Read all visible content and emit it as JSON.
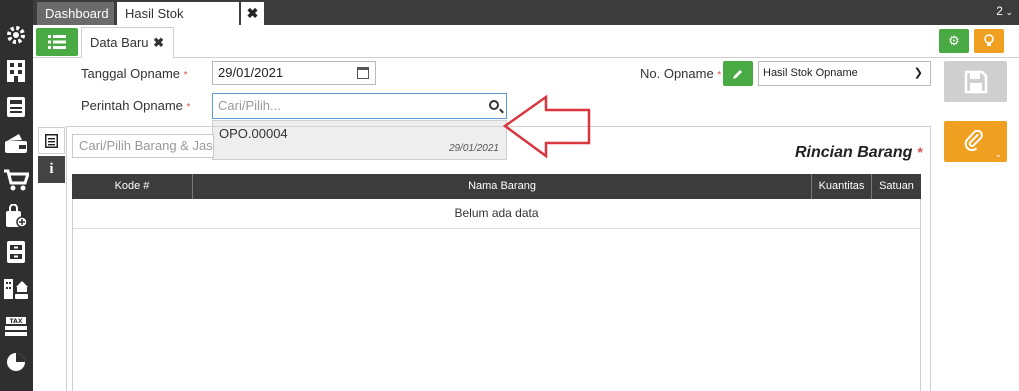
{
  "top_tabs": [
    {
      "label": "Dashboard"
    },
    {
      "label": "Hasil Stok Opname"
    }
  ],
  "top_tabs_count": "2",
  "sidebar_icons": [
    "settings-gear-icon",
    "building-icon",
    "calculator-icon",
    "wallet-icon",
    "cart-icon",
    "bag-icon",
    "cabinet-icon",
    "office-car-icon",
    "tax-icon",
    "pie-chart-icon"
  ],
  "subtab": {
    "label": "Data Baru"
  },
  "form": {
    "tanggal_label": "Tanggal Opname",
    "tanggal_value": "29/01/2021",
    "perintah_label": "Perintah Opname",
    "perintah_placeholder": "Cari/Pilih...",
    "no_label": "No. Opname",
    "no_select_value": "Hasil Stok Opname",
    "required_mark": "*"
  },
  "dropdown": {
    "items": [
      {
        "code": "OPO.00004",
        "date": "29/01/2021"
      }
    ]
  },
  "details": {
    "search_placeholder": "Cari/Pilih Barang & Jasa...",
    "title": "Rincian Barang",
    "columns": [
      "Kode #",
      "Nama Barang",
      "Kuantitas",
      "Satuan"
    ],
    "empty_text": "Belum ada data"
  },
  "colors": {
    "green": "#49a942",
    "orange": "#f0a020",
    "dark": "#2f2f2f",
    "arrow": "#d9363e"
  }
}
